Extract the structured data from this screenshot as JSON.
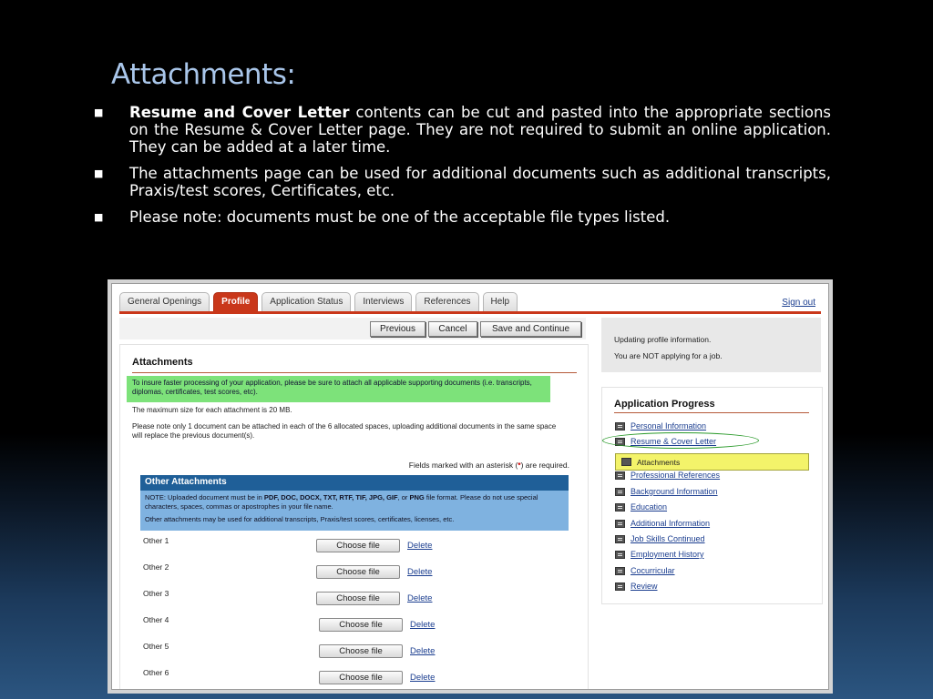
{
  "slide": {
    "title": "Attachments:",
    "bullets": [
      {
        "bold": "Resume and Cover Letter",
        "text": " contents can be cut and pasted into the appropriate sections on the Resume & Cover Letter page.  They are not required to submit an online application.  They can be added at a later time."
      },
      {
        "bold": "",
        "text": "The attachments page can be used for additional documents such as additional transcripts, Praxis/test scores, Certificates, etc."
      },
      {
        "bold": "",
        "text": "Please note: documents must be one of the acceptable file types listed."
      }
    ]
  },
  "nav": {
    "tabs": [
      "General Openings",
      "Profile",
      "Application Status",
      "Interviews",
      "References",
      "Help"
    ],
    "active_tab": "Profile",
    "sign_out": "Sign out"
  },
  "toolbar": {
    "previous": "Previous",
    "cancel": "Cancel",
    "save_continue": "Save and Continue"
  },
  "attachments": {
    "title": "Attachments",
    "green_note": "To insure faster processing of your application, please be sure to attach all applicable supporting documents (i.e. transcripts, diplomas, certificates, test scores, etc).",
    "max_size": "The maximum size for each attachment is 20 MB.",
    "note_one_doc": "Please note only 1 document can be attached in each of the 6 allocated spaces, uploading additional documents in the same space will replace the previous document(s).",
    "required_prefix": "Fields marked with an asterisk (",
    "required_star": "*",
    "required_suffix": ") are required."
  },
  "other_attachments": {
    "title": "Other Attachments",
    "note_prefix": "NOTE: Uploaded document must be in ",
    "formats": "PDF, DOC, DOCX, TXT, RTF, TIF, JPG, GIF",
    "note_or": ", or ",
    "format_last": "PNG",
    "note_suffix": " file format. Please do not use special characters, spaces, commas or apostrophes in your file name.",
    "note2": "Other attachments may be used for additional transcripts, Praxis/test scores, certificates, licenses, etc.",
    "rows": [
      {
        "label": "Other 1",
        "choose": "Choose file",
        "delete": "Delete"
      },
      {
        "label": "Other 2",
        "choose": "Choose file",
        "delete": "Delete"
      },
      {
        "label": "Other 3",
        "choose": "Choose file",
        "delete": "Delete"
      },
      {
        "label": "Other 4",
        "choose": "Choose file",
        "delete": "Delete"
      },
      {
        "label": "Other 5",
        "choose": "Choose file",
        "delete": "Delete"
      },
      {
        "label": "Other 6",
        "choose": "Choose file",
        "delete": "Delete"
      }
    ]
  },
  "status_box": {
    "line1": "Updating profile information.",
    "line2": "You are NOT applying for a job."
  },
  "progress": {
    "title": "Application Progress",
    "items": [
      "Personal Information",
      "Resume & Cover Letter",
      "Attachments",
      "Professional References",
      "Background Information",
      "Education",
      "Additional Information",
      "Job Skills Continued",
      "Employment History",
      "Cocurricular",
      "Review"
    ],
    "current": "Attachments",
    "highlight_color": "#f3f36a",
    "circle_color": "#2a9a2a"
  },
  "colors": {
    "accent": "#c9371a",
    "section_header": "#1f5f98",
    "note_blue": "#7fb2e0",
    "note_green": "#7de27a",
    "link": "#1a3d8f",
    "title": "#a9c6ea"
  },
  "icons": {
    "bullet": "square-bullet-icon",
    "progress_item": "document-icon"
  }
}
